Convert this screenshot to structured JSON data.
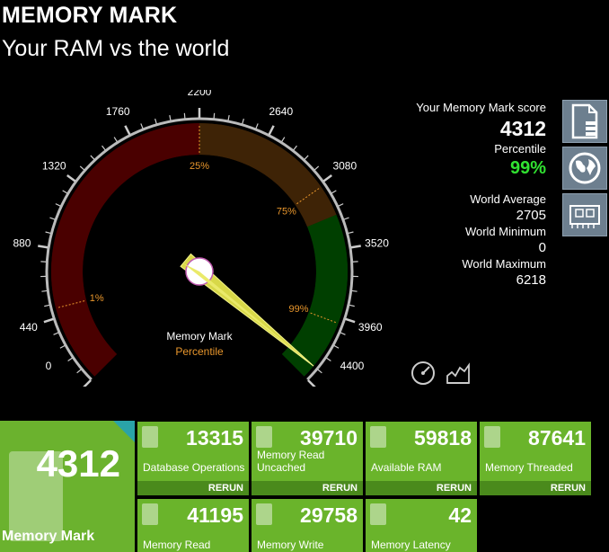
{
  "header": {
    "title": "MEMORY MARK",
    "subtitle": "Your RAM vs the world"
  },
  "gauge": {
    "ticks": [
      "0",
      "440",
      "880",
      "1320",
      "1760",
      "2200",
      "2640",
      "3080",
      "3520",
      "3960",
      "4400"
    ],
    "percent_labels": [
      {
        "value": 500,
        "text": "1%"
      },
      {
        "value": 2200,
        "text": "25%"
      },
      {
        "value": 3100,
        "text": "75%"
      },
      {
        "value": 4000,
        "text": "99%"
      }
    ],
    "caption_top": "Memory Mark",
    "caption_bottom": "Percentile",
    "max": 4400,
    "needle_value": 4312,
    "zones": [
      {
        "from": 0,
        "to": 2200,
        "color": "#4a0000"
      },
      {
        "from": 2200,
        "to": 3300,
        "color": "#3e2306"
      },
      {
        "from": 3300,
        "to": 4400,
        "color": "#003f00"
      }
    ],
    "accent_orange": "#e8962c"
  },
  "stats": {
    "score_label": "Your Memory Mark score",
    "score": "4312",
    "percentile_label": "Percentile",
    "percentile": "99%",
    "avg_label": "World Average",
    "avg": "2705",
    "min_label": "World Minimum",
    "min": "0",
    "max_label": "World Maximum",
    "max": "6218"
  },
  "side_buttons": [
    "document-icon",
    "globe-icon",
    "ram-module-icon"
  ],
  "mini_icons": [
    "speedometer-icon",
    "chart-icon"
  ],
  "big_tile": {
    "score": "4312",
    "label": "Memory Mark"
  },
  "tiles": [
    {
      "value": "13315",
      "name": "Database Operations",
      "rerun": "RERUN"
    },
    {
      "value": "39710",
      "name": "Memory Read Uncached",
      "rerun": "RERUN"
    },
    {
      "value": "59818",
      "name": "Available RAM",
      "rerun": "RERUN"
    },
    {
      "value": "87641",
      "name": "Memory Threaded",
      "rerun": "RERUN"
    },
    {
      "value": "41195",
      "name": "Memory Read Cached"
    },
    {
      "value": "29758",
      "name": "Memory Write"
    },
    {
      "value": "42",
      "name": "Memory Latency"
    }
  ],
  "colors": {
    "tile_green": "#6ab42b",
    "rerun_bar": "#4a8a1c",
    "percent_green": "#31e231",
    "corner_teal": "#2aa3a8"
  }
}
